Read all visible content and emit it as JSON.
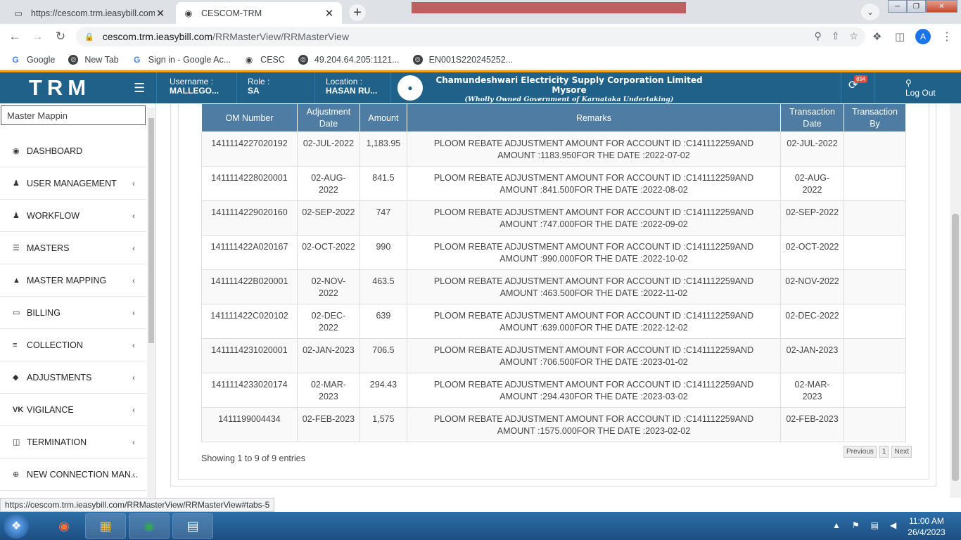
{
  "browser": {
    "tabs": [
      {
        "title": "https://cescom.trm.ieasybill.com/",
        "active": false
      },
      {
        "title": "CESCOM-TRM",
        "active": true
      }
    ],
    "url_host": "cescom.trm.ieasybill.com",
    "url_path": "/RRMasterView/RRMasterView",
    "profile_initial": "A",
    "bookmarks": [
      {
        "label": "Google",
        "icon": "google-icon"
      },
      {
        "label": "New Tab",
        "icon": "globe-icon"
      },
      {
        "label": "Sign in - Google Ac...",
        "icon": "google-icon"
      },
      {
        "label": "CESC",
        "icon": "cesc-icon"
      },
      {
        "label": "49.204.64.205:1121...",
        "icon": "globe-icon"
      },
      {
        "label": "EN001S220245252...",
        "icon": "globe-icon"
      }
    ],
    "status_url": "https://cescom.trm.ieasybill.com/RRMasterView/RRMasterView#tabs-5"
  },
  "header": {
    "brand": "TRM",
    "username_label": "Username :",
    "username_value": "MALLEGO...",
    "role_label": "Role :",
    "role_value": "SA",
    "location_label": "Location :",
    "location_value": "HASAN RU...",
    "org_name": "Chamundeshwari Electricity Supply Corporation Limited Mysore",
    "org_sub": "(Wholly Owned Government of Karnataka Undertaking)",
    "notification_count": "894",
    "logout_label": "Log Out",
    "accent_color": "#1f6189"
  },
  "sidebar": {
    "search_value": "Master Mappin",
    "items": [
      {
        "label": "DASHBOARD",
        "icon": "dashboard-icon",
        "chevron": false
      },
      {
        "label": "USER MANAGEMENT",
        "icon": "user-icon",
        "chevron": true
      },
      {
        "label": "WORKFLOW",
        "icon": "user-icon",
        "chevron": true
      },
      {
        "label": "MASTERS",
        "icon": "list-icon",
        "chevron": true
      },
      {
        "label": "MASTER MAPPING",
        "icon": "sitemap-icon",
        "chevron": true
      },
      {
        "label": "BILLING",
        "icon": "monitor-icon",
        "chevron": true
      },
      {
        "label": "COLLECTION",
        "icon": "list-ol-icon",
        "chevron": true
      },
      {
        "label": "ADJUSTMENTS",
        "icon": "binoculars-icon",
        "chevron": true
      },
      {
        "label": "VIGILANCE",
        "icon": "vk-icon",
        "chevron": true
      },
      {
        "label": "TERMINATION",
        "icon": "trash-icon",
        "chevron": true
      },
      {
        "label": "NEW CONNECTION MAN...",
        "icon": "plus-circle-icon",
        "chevron": true
      }
    ]
  },
  "table": {
    "headers": [
      "OM Number",
      "Adjustment Date",
      "Amount",
      "Remarks",
      "Transaction Date",
      "Transaction By"
    ],
    "rows": [
      [
        "1411114227020192",
        "02-JUL-2022",
        "1,183.95",
        "PLOOM REBATE ADJUSTMENT AMOUNT FOR ACCOUNT ID :C141112259AND AMOUNT :1183.950FOR THE DATE :2022-07-02",
        "02-JUL-2022",
        ""
      ],
      [
        "1411114228020001",
        "02-AUG-2022",
        "841.5",
        "PLOOM REBATE ADJUSTMENT AMOUNT FOR ACCOUNT ID :C141112259AND AMOUNT :841.500FOR THE DATE :2022-08-02",
        "02-AUG-2022",
        ""
      ],
      [
        "1411114229020160",
        "02-SEP-2022",
        "747",
        "PLOOM REBATE ADJUSTMENT AMOUNT FOR ACCOUNT ID :C141112259AND AMOUNT :747.000FOR THE DATE :2022-09-02",
        "02-SEP-2022",
        ""
      ],
      [
        "141111422A020167",
        "02-OCT-2022",
        "990",
        "PLOOM REBATE ADJUSTMENT AMOUNT FOR ACCOUNT ID :C141112259AND AMOUNT :990.000FOR THE DATE :2022-10-02",
        "02-OCT-2022",
        ""
      ],
      [
        "141111422B020001",
        "02-NOV-2022",
        "463.5",
        "PLOOM REBATE ADJUSTMENT AMOUNT FOR ACCOUNT ID :C141112259AND AMOUNT :463.500FOR THE DATE :2022-11-02",
        "02-NOV-2022",
        ""
      ],
      [
        "141111422C020102",
        "02-DEC-2022",
        "639",
        "PLOOM REBATE ADJUSTMENT AMOUNT FOR ACCOUNT ID :C141112259AND AMOUNT :639.000FOR THE DATE :2022-12-02",
        "02-DEC-2022",
        ""
      ],
      [
        "1411114231020001",
        "02-JAN-2023",
        "706.5",
        "PLOOM REBATE ADJUSTMENT AMOUNT FOR ACCOUNT ID :C141112259AND AMOUNT :706.500FOR THE DATE :2023-01-02",
        "02-JAN-2023",
        ""
      ],
      [
        "1411114233020174",
        "02-MAR-2023",
        "294.43",
        "PLOOM REBATE ADJUSTMENT AMOUNT FOR ACCOUNT ID :C141112259AND AMOUNT :294.430FOR THE DATE :2023-03-02",
        "02-MAR-2023",
        ""
      ],
      [
        "1411199004434",
        "02-FEB-2023",
        "1,575",
        "PLOOM REBATE ADJUSTMENT AMOUNT FOR ACCOUNT ID :C141112259AND AMOUNT :1575.000FOR THE DATE :2023-02-02",
        "02-FEB-2023",
        ""
      ]
    ],
    "info": "Showing 1 to 9 of 9 entries",
    "pager": {
      "previous": "Previous",
      "page": "1",
      "next": "Next"
    }
  },
  "taskbar": {
    "time": "11:00 AM",
    "date": "26/4/2023"
  }
}
